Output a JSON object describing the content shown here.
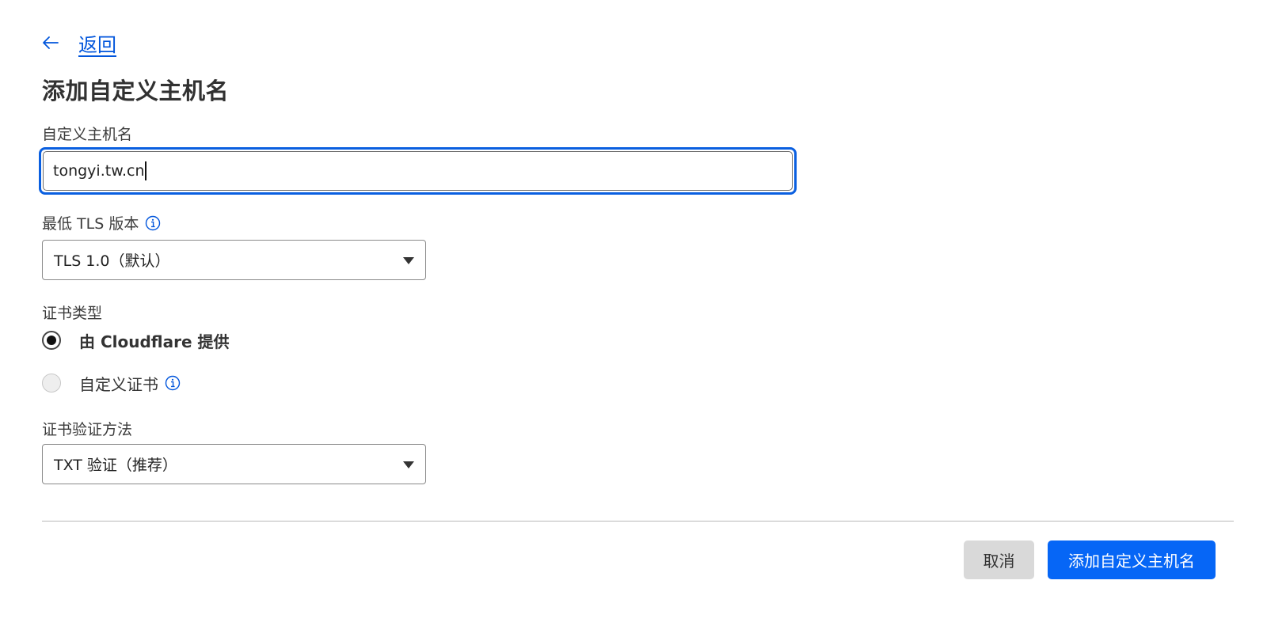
{
  "back": {
    "label": "返回",
    "icon": "arrow-left-icon"
  },
  "title": "添加自定义主机名",
  "hostname": {
    "label": "自定义主机名",
    "value": "tongyi.tw.cn"
  },
  "tls": {
    "label": "最低 TLS 版本",
    "info_icon": "info-icon",
    "selected": "TLS 1.0（默认）"
  },
  "certificate_type": {
    "label": "证书类型",
    "options": [
      {
        "label": "由 Cloudflare 提供",
        "selected": true
      },
      {
        "label": "自定义证书",
        "selected": false
      }
    ]
  },
  "validation": {
    "label": "证书验证方法",
    "selected": "TXT 验证（推荐）"
  },
  "actions": {
    "cancel": "取消",
    "submit": "添加自定义主机名"
  },
  "colors": {
    "accent": "#0666f6",
    "link": "#0055dc",
    "focus_border": "#0a5fe0"
  }
}
